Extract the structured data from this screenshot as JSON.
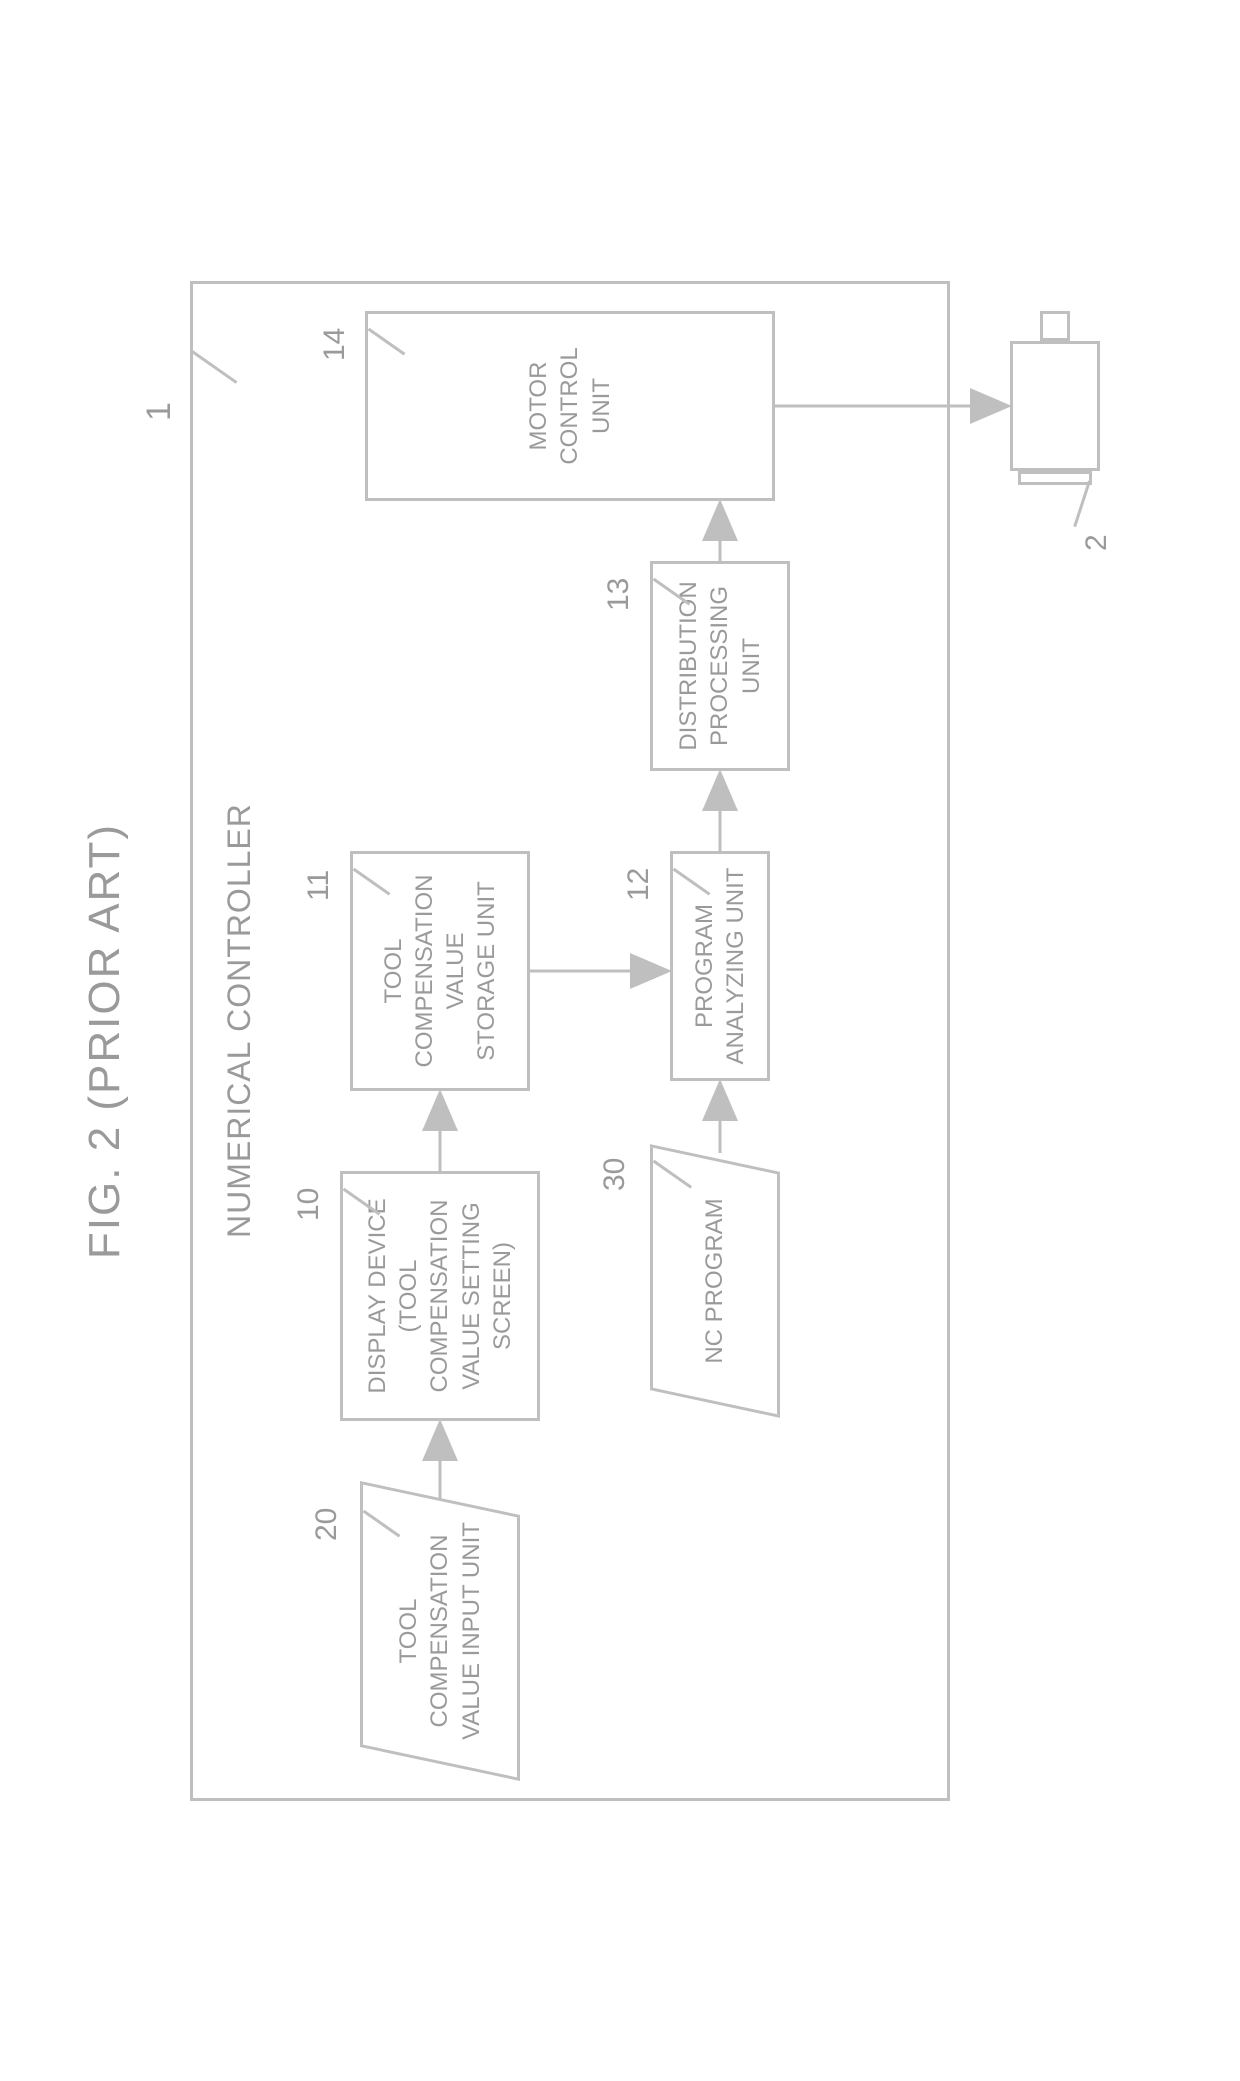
{
  "figure": {
    "title": "FIG. 2 (PRIOR ART)",
    "controller_label": "NUMERICAL CONTROLLER",
    "controller_ref": "1",
    "motor_ref": "2"
  },
  "blocks": {
    "input": {
      "ref": "20",
      "label": "TOOL\nCOMPENSATION\nVALUE INPUT UNIT"
    },
    "display": {
      "ref": "10",
      "label": "DISPLAY DEVICE\n(TOOL\nCOMPENSATION\nVALUE SETTING\nSCREEN)"
    },
    "storage": {
      "ref": "11",
      "label": "TOOL\nCOMPENSATION\nVALUE\nSTORAGE UNIT"
    },
    "ncprogram": {
      "ref": "30",
      "label": "NC PROGRAM"
    },
    "analyze": {
      "ref": "12",
      "label": "PROGRAM\nANALYZING UNIT"
    },
    "dist": {
      "ref": "13",
      "label": "DISTRIBUTION\nPROCESSING\nUNIT"
    },
    "motorctl": {
      "ref": "14",
      "label": "MOTOR\nCONTROL UNIT"
    }
  }
}
